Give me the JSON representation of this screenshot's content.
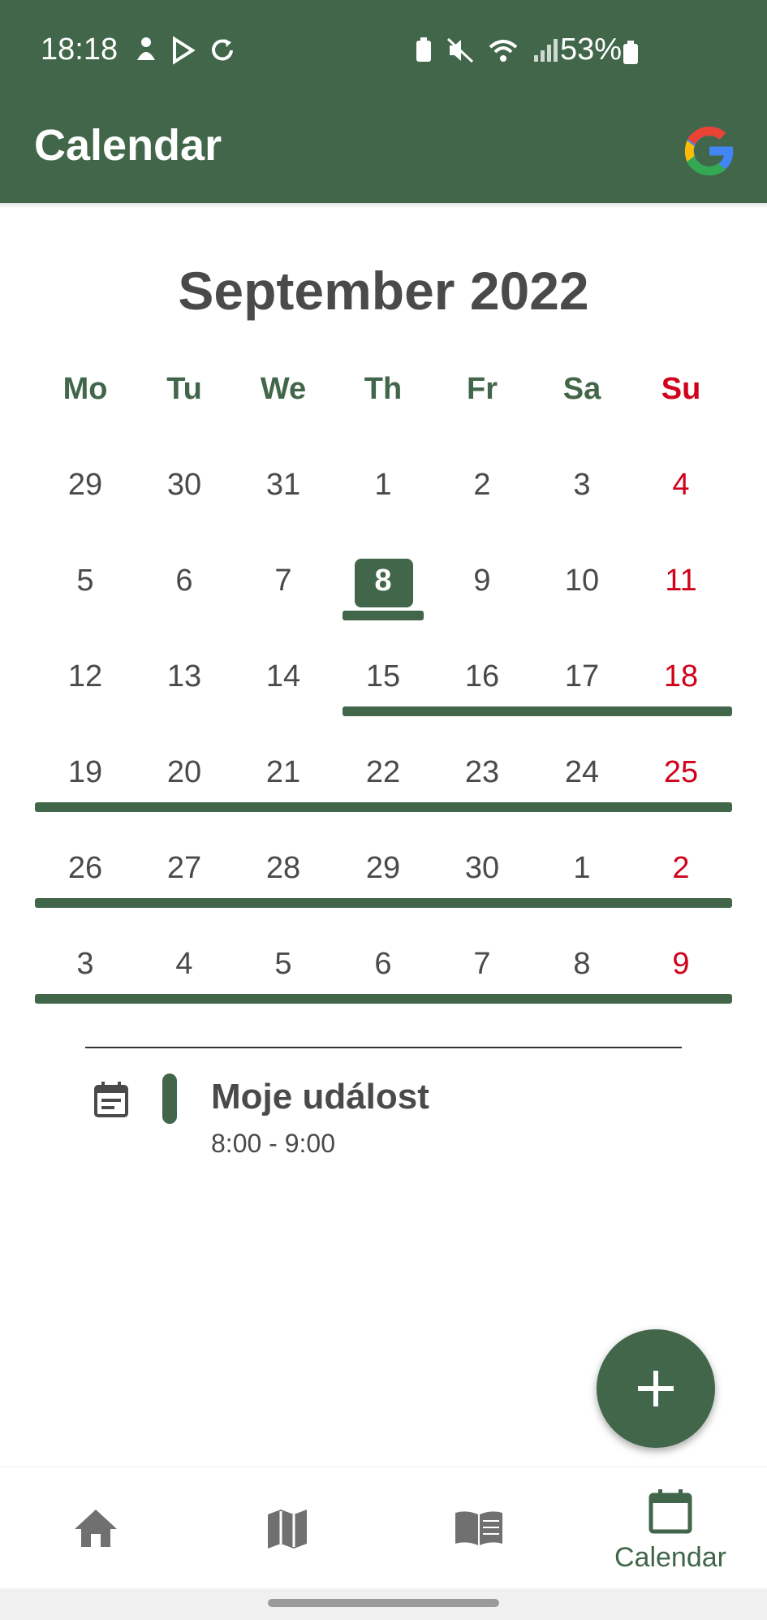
{
  "status_bar": {
    "time": "18:18",
    "battery": "53%"
  },
  "app_bar": {
    "title": "Calendar",
    "account_icon": "google-g-icon"
  },
  "calendar": {
    "month_label": "September 2022",
    "weekdays": [
      "Mo",
      "Tu",
      "We",
      "Th",
      "Fr",
      "Sa",
      "Su"
    ],
    "weeks": [
      [
        "29",
        "30",
        "31",
        "1",
        "2",
        "3",
        "4"
      ],
      [
        "5",
        "6",
        "7",
        "8",
        "9",
        "10",
        "11"
      ],
      [
        "12",
        "13",
        "14",
        "15",
        "16",
        "17",
        "18"
      ],
      [
        "19",
        "20",
        "21",
        "22",
        "23",
        "24",
        "25"
      ],
      [
        "26",
        "27",
        "28",
        "29",
        "30",
        "1",
        "2"
      ],
      [
        "3",
        "4",
        "5",
        "6",
        "7",
        "8",
        "9"
      ]
    ],
    "selected_day": "8",
    "accent_color": "#41664a",
    "sunday_color": "#d0021b"
  },
  "events": [
    {
      "title": "Moje událost",
      "time": "8:00 - 9:00",
      "icon": "event-note-icon"
    }
  ],
  "fab": {
    "icon": "plus-icon"
  },
  "bottom_nav": {
    "items": [
      {
        "icon": "home-icon",
        "label": ""
      },
      {
        "icon": "map-icon",
        "label": ""
      },
      {
        "icon": "book-icon",
        "label": ""
      },
      {
        "icon": "calendar-icon",
        "label": "Calendar",
        "active": true
      }
    ]
  }
}
